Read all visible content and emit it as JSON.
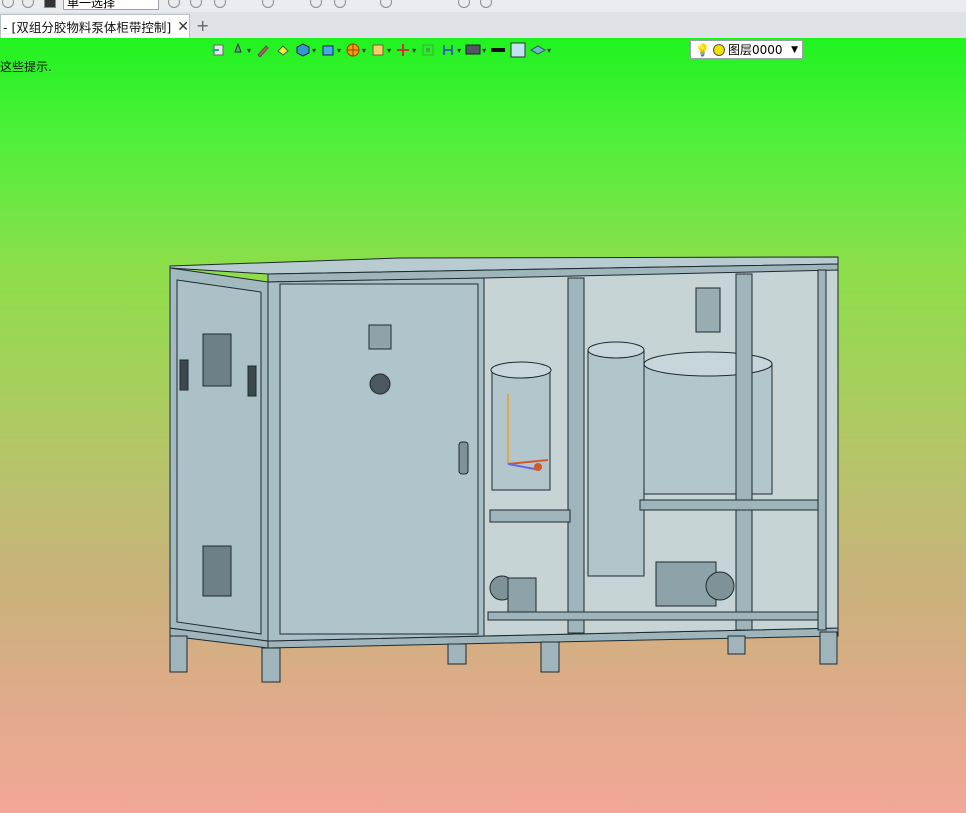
{
  "toolbar": {
    "selection_mode": "单一选择"
  },
  "tabs": [
    {
      "label": "- [双组分胶物料泵体柜带控制]",
      "close": "✕"
    }
  ],
  "tab_add": "+",
  "viewport": {
    "hint_text": "这些提示.",
    "layer": {
      "name": "图层0000"
    },
    "background_top": "#1ff31f",
    "background_bottom": "#f2a798"
  },
  "model": {
    "body_color": "#a9bfc6",
    "edge_color": "#1d2a2f"
  }
}
